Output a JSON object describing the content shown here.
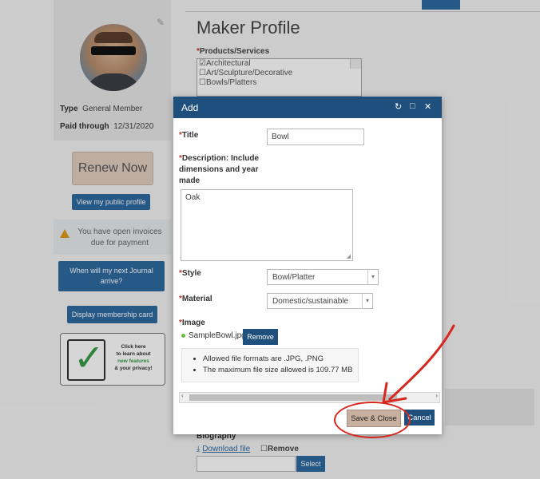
{
  "profile": {
    "type_label": "Type",
    "type_value": "General Member",
    "paid_label": "Paid through",
    "paid_value": "12/31/2020",
    "renew_label": "Renew Now",
    "public_profile_label": "View my public profile",
    "invoices_text": "You have open invoices due for payment",
    "journal_label": "When will my next Journal arrive?",
    "membership_card_label": "Display membership card",
    "privacy_card": {
      "line1": "Click here",
      "line2": "to learn about",
      "line3": "new features",
      "line4": "& your privacy!"
    }
  },
  "main": {
    "title": "Maker Profile",
    "products_label": "Products/Services",
    "products": [
      {
        "label": "Architectural",
        "checked": true
      },
      {
        "label": "Art/Sculpture/Decorative",
        "checked": false
      },
      {
        "label": "Bowls/Platters",
        "checked": false
      }
    ],
    "biography_label": "Biography",
    "download_label": "Download file",
    "remove_label": "Remove",
    "select_label": "Select"
  },
  "dialog": {
    "title": "Add",
    "title_label": "Title",
    "title_value": "Bowl",
    "description_label_1": "Description: Include",
    "description_label_2": "dimensions and year",
    "description_label_3": "made",
    "description_value": "Oak",
    "style_label": "Style",
    "style_value": "Bowl/Platter",
    "material_label": "Material",
    "material_value": "Domestic/sustainable",
    "image_label": "Image",
    "image_file": "SampleBowl.jpg",
    "remove_label": "Remove",
    "notes": [
      "Allowed file formats are .JPG, .PNG",
      "The maximum file size allowed is 109.77 MB"
    ],
    "save_label": "Save & Close",
    "cancel_label": "Cancel"
  },
  "colors": {
    "header": "#1f4f7c",
    "accent_blue": "#2f6aa0",
    "save_bg": "#c7b09f",
    "annotation_red": "#d6281e"
  }
}
